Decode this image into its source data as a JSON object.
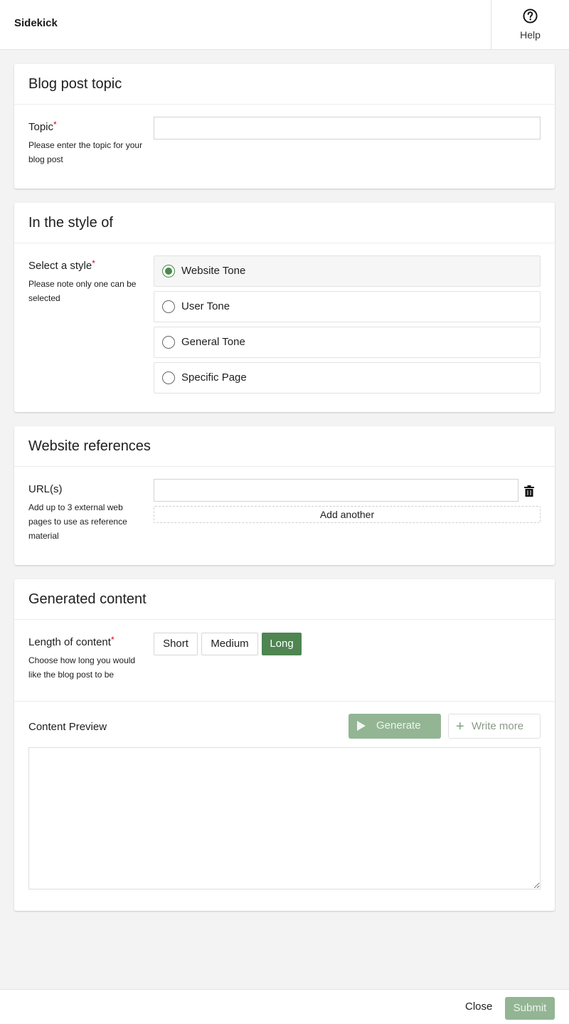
{
  "header": {
    "app_title": "Sidekick",
    "help_label": "Help",
    "help_icon": "question-circle-icon"
  },
  "sections": {
    "topic": {
      "title": "Blog post topic",
      "label": "Topic",
      "required_marker": "*",
      "help": "Please enter the topic for your blog post",
      "value": "",
      "placeholder": ""
    },
    "style": {
      "title": "In the style of",
      "label": "Select a style",
      "required_marker": "*",
      "help": "Please note only one can be selected",
      "options": [
        {
          "label": "Website Tone",
          "selected": true
        },
        {
          "label": "User Tone",
          "selected": false
        },
        {
          "label": "General Tone",
          "selected": false
        },
        {
          "label": "Specific Page",
          "selected": false
        }
      ]
    },
    "references": {
      "title": "Website references",
      "label": "URL(s)",
      "help": "Add up to 3 external web pages to use as reference material",
      "urls": [
        ""
      ],
      "delete_icon": "trash-icon",
      "add_another_label": "Add another"
    },
    "generated": {
      "title": "Generated content",
      "length_label": "Length of content",
      "required_marker": "*",
      "length_help": "Choose how long you would like the blog post to be",
      "length_options": [
        {
          "label": "Short",
          "selected": false
        },
        {
          "label": "Medium",
          "selected": false
        },
        {
          "label": "Long",
          "selected": true
        }
      ],
      "preview_label": "Content Preview",
      "generate_label": "Generate",
      "generate_icon": "play-icon",
      "write_more_label": "Write more",
      "write_more_icon": "plus-icon",
      "preview_value": ""
    }
  },
  "footer": {
    "close_label": "Close",
    "submit_label": "Submit"
  },
  "colors": {
    "accent": "#4e8551",
    "accent_disabled": "#93b594",
    "required": "#d0021b",
    "background": "#f4f3f3"
  }
}
